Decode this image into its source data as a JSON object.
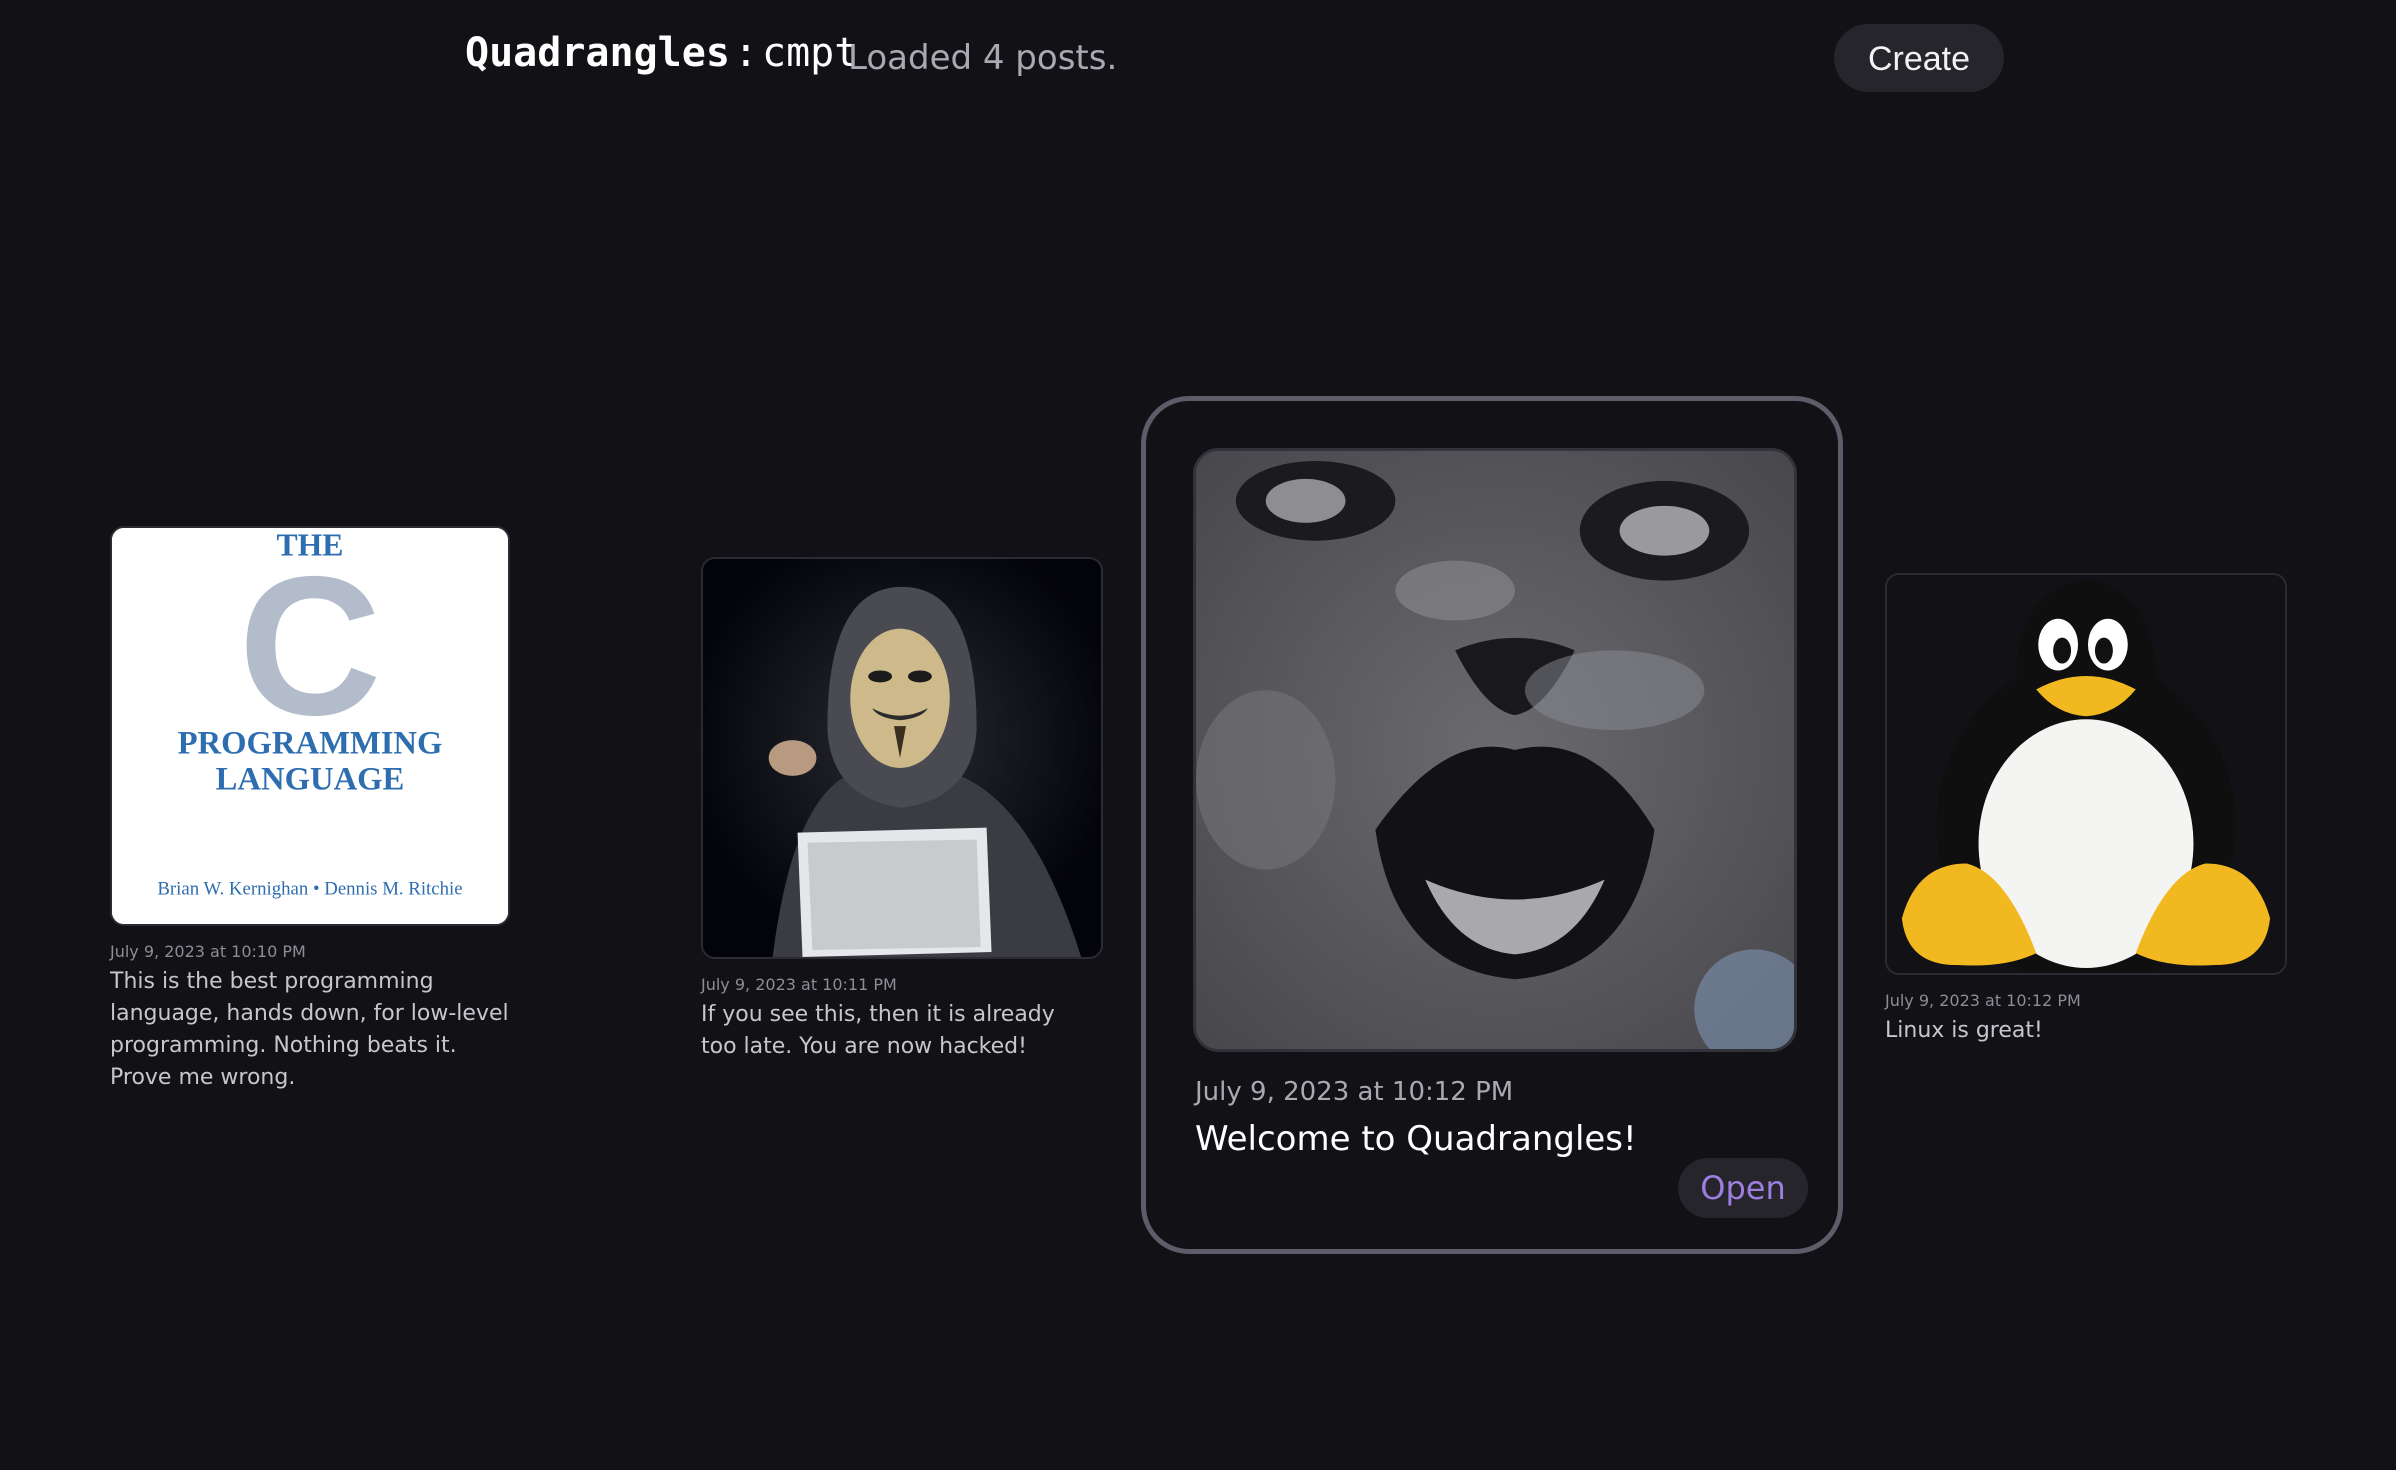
{
  "header": {
    "brand_name": "Quadrangles",
    "brand_separator": ":",
    "brand_sub": "cmpt",
    "status": "Loaded 4 posts.",
    "create_label": "Create"
  },
  "posts": [
    {
      "date": "July 9, 2023 at 10:10 PM",
      "caption": "This is the best programming language, hands down, for low-level programming. Nothing beats it. Prove me wrong.",
      "image": {
        "kind": "book-cover",
        "line1": "THE",
        "big_letter": "C",
        "line2": "PROGRAMMING",
        "line3": "LANGUAGE",
        "authors": "Brian W. Kernighan • Dennis M. Ritchie"
      }
    },
    {
      "date": "July 9, 2023 at 10:11 PM",
      "caption": "If you see this, then it is already too late. You are now hacked!",
      "image": {
        "kind": "hooded-hacker-with-mask-and-laptop"
      }
    },
    {
      "date": "July 9, 2023 at 10:12 PM",
      "caption": "Welcome to Quadrangles!",
      "open_label": "Open",
      "featured": true,
      "image": {
        "kind": "smiling-cat-closeup"
      }
    },
    {
      "date": "July 9, 2023 at 10:12 PM",
      "caption": "Linux is great!",
      "image": {
        "kind": "tux-penguin"
      }
    }
  ],
  "colors": {
    "background": "#121116",
    "accent": "#9d7fe0",
    "book_blue": "#2e6db0",
    "book_letter_gray": "#b3bccb"
  }
}
